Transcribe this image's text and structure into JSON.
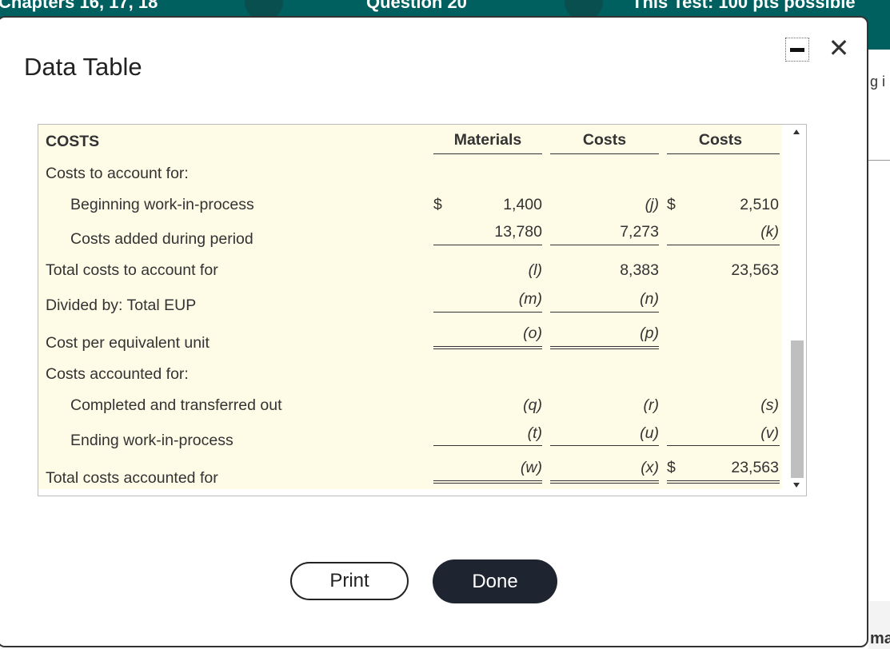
{
  "background": {
    "header_segments": [
      "Chapters 16, 17, 18",
      "Question 20",
      "This Test: 100 pts possible"
    ],
    "right_fragment_top": "g i",
    "right_fragment_bottom": "ma"
  },
  "dialog": {
    "title": "Data Table",
    "minimize_icon": "minimize-icon",
    "close_icon": "close-icon",
    "close_glyph": "✕"
  },
  "table": {
    "section_label": "COSTS",
    "column_headers": [
      "Materials",
      "Costs",
      "Costs"
    ],
    "rows": {
      "costs_to_account_for": "Costs to account for:",
      "beginning_wip": {
        "label": "Beginning work-in-process",
        "currency": "$",
        "materials": "1,400",
        "conversion": "(j)",
        "conversion_currency": "$",
        "total": "2,510"
      },
      "costs_added": {
        "label": "Costs added during period",
        "materials": "13,780",
        "conversion": "7,273",
        "total": "(k)"
      },
      "total_to_account": {
        "label": "Total costs to account for",
        "materials": "(l)",
        "conversion": "8,383",
        "total": "23,563"
      },
      "divided_by": {
        "label": "Divided by: Total EUP",
        "materials": "(m)",
        "conversion": "(n)"
      },
      "cost_per_eu": {
        "label": "Cost per equivalent unit",
        "materials": "(o)",
        "conversion": "(p)"
      },
      "costs_accounted_for": "Costs accounted for:",
      "completed": {
        "label": "Completed and transferred out",
        "materials": "(q)",
        "conversion": "(r)",
        "total": "(s)"
      },
      "ending_wip": {
        "label": "Ending work-in-process",
        "materials": "(t)",
        "conversion": "(u)",
        "total": "(v)"
      },
      "total_accounted": {
        "label": "Total costs accounted for",
        "materials": "(w)",
        "conversion": "(x)",
        "conversion_currency": "$",
        "total": "23,563"
      }
    }
  },
  "buttons": {
    "print": "Print",
    "done": "Done"
  }
}
